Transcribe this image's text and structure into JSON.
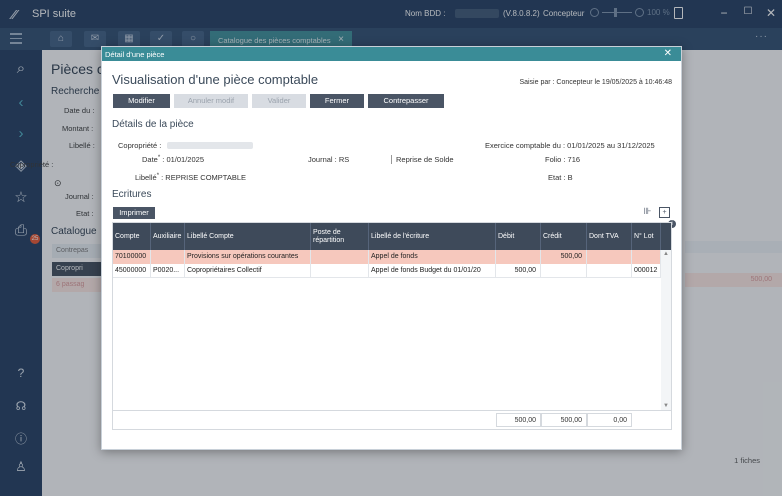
{
  "app": {
    "title": "SPI suite",
    "db_label": "Nom BDD :",
    "version": "(V.8.0.8.2)",
    "role": "Concepteur",
    "zoom": "100 %"
  },
  "tabs": {
    "active": "Catalogue des pièces comptables"
  },
  "background": {
    "title": "Pièces co",
    "search_title": "Recherche",
    "labels": [
      "Date du :",
      "Montant :",
      "Libellé :",
      "Copropriété :",
      "Journal :",
      "Etat :"
    ],
    "catalog_title": "Catalogue",
    "col": "Contrepas",
    "row1": "Copropri",
    "row2": "6 passag",
    "amount": "500,00",
    "count": "1 fiches"
  },
  "modal": {
    "header": "Détail d'une pièce",
    "title": "Visualisation d'une pièce comptable",
    "saisie": "Saisie par : Concepteur le 19/05/2025 à 10:46:48",
    "buttons": {
      "modifier": "Modifier",
      "annuler": "Annuler modif",
      "valider": "Valider",
      "fermer": "Fermer",
      "contrepasser": "Contrepasser"
    },
    "details_title": "Détails de la pièce",
    "labels": {
      "copro": "Copropriété :",
      "date": "Date",
      "date_value": ": 01/01/2025",
      "journal": "Journal :",
      "journal_value": "RS",
      "journal_desc": "Reprise de Solde",
      "libelle": "Libellé",
      "libelle_value": ": REPRISE COMPTABLE",
      "exercice": "Exercice comptable du : 01/01/2025 au 31/12/2025",
      "folio": "Folio :",
      "folio_value": "716",
      "etat": "Etat :",
      "etat_value": "B"
    },
    "ecritures_title": "Ecritures",
    "print_label": "Imprimer",
    "columns": [
      "Compte",
      "Auxiliaire",
      "Libellé Compte",
      "Poste de répartition",
      "Libellé de l'écriture",
      "Débit",
      "Crédit",
      "Dont TVA",
      "N° Lot"
    ],
    "rows": [
      {
        "compte": "70100000",
        "aux": "",
        "lib_compte": "Provisions sur opérations courantes",
        "poste": "",
        "lib_ecriture": "Appel de fonds",
        "debit": "",
        "credit": "500,00",
        "tva": "",
        "lot": ""
      },
      {
        "compte": "45000000",
        "aux": "P0020...",
        "lib_compte": "Copropriétaires Collectif",
        "poste": "",
        "lib_ecriture": "Appel de fonds Budget du 01/01/20",
        "debit": "500,00",
        "credit": "",
        "tva": "",
        "lot": "000012"
      }
    ],
    "totals": {
      "debit": "500,00",
      "credit": "500,00",
      "tva": "0,00"
    }
  }
}
